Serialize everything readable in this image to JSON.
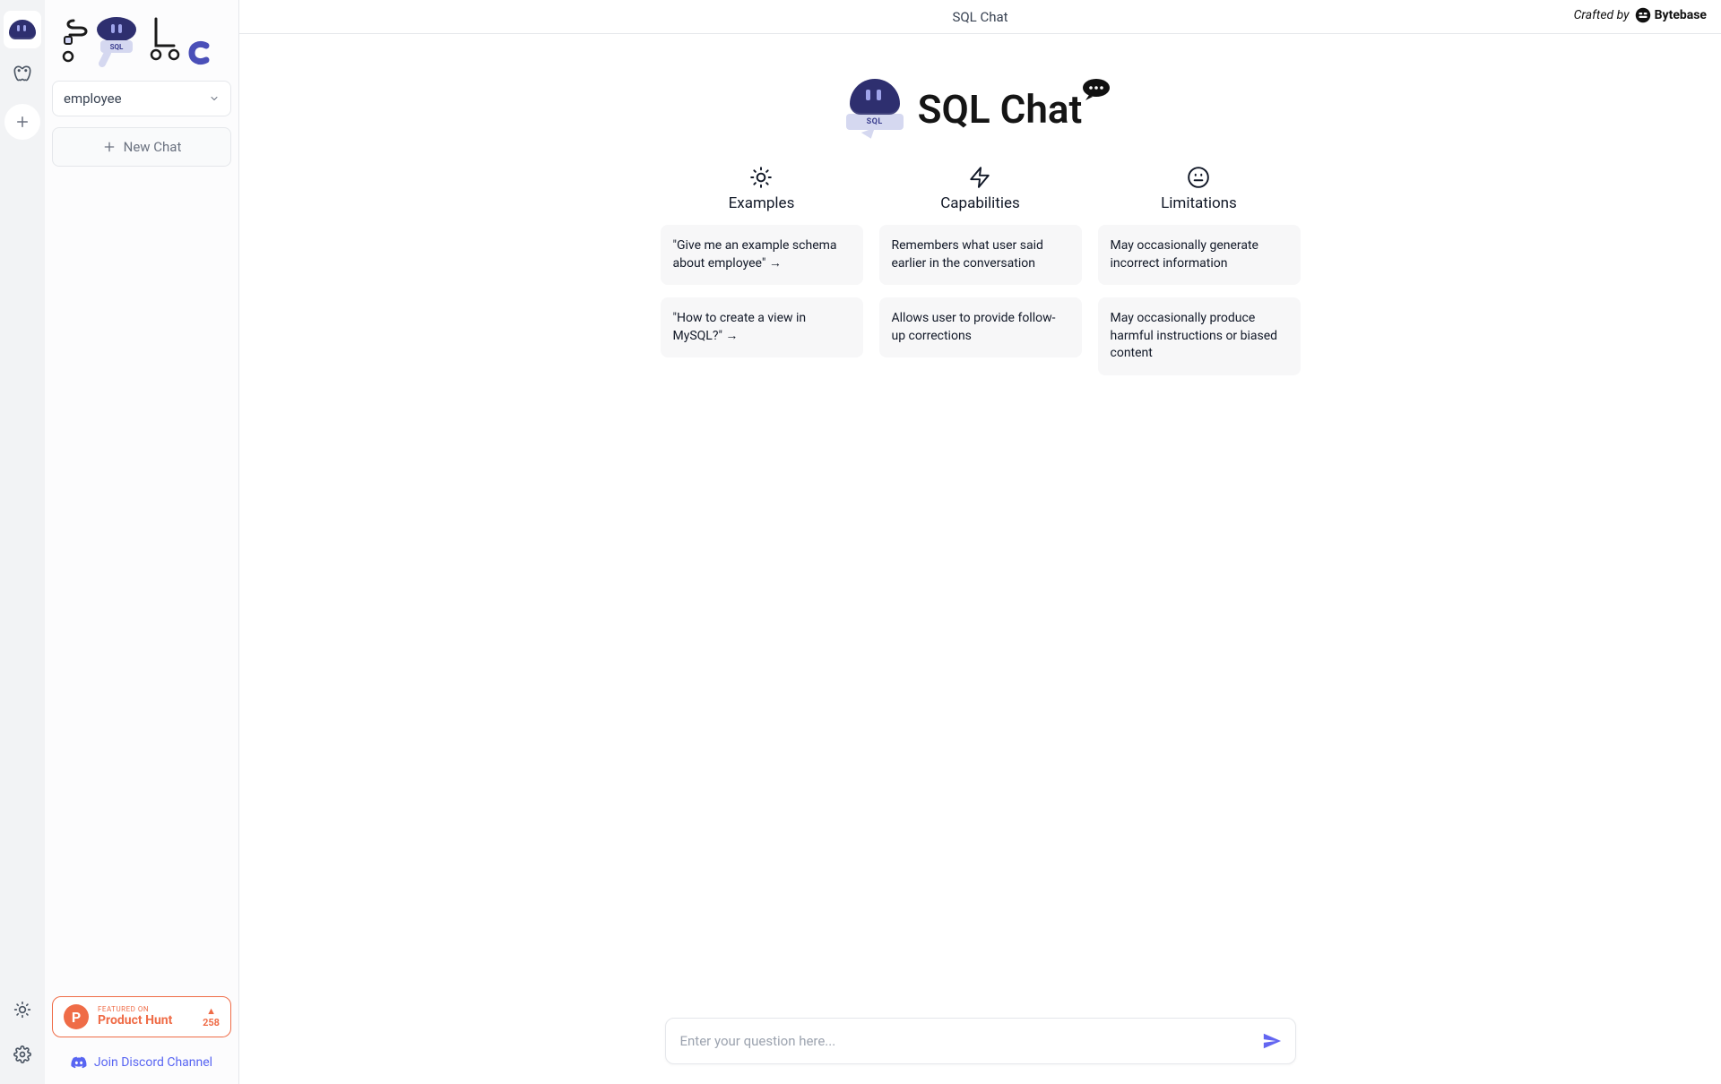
{
  "header": {
    "title": "SQL Chat",
    "crafted_by": "Crafted by",
    "brand": "Bytebase"
  },
  "sidebar": {
    "logo_text": "SQLc",
    "selected_db": "employee",
    "new_chat": "New Chat",
    "ph_featured": "FEATURED ON",
    "ph_name": "Product Hunt",
    "ph_count": "258",
    "discord": "Join Discord Channel"
  },
  "hero": {
    "title": "SQL Chat"
  },
  "columns": {
    "examples": {
      "title": "Examples",
      "items": [
        "\"Give me an example schema about employee\" →",
        "\"How to create a view in MySQL?\" →"
      ]
    },
    "capabilities": {
      "title": "Capabilities",
      "items": [
        "Remembers what user said earlier in the conversation",
        "Allows user to provide follow-up corrections"
      ]
    },
    "limitations": {
      "title": "Limitations",
      "items": [
        "May occasionally generate incorrect information",
        "May occasionally produce harmful instructions or biased content"
      ]
    }
  },
  "composer": {
    "placeholder": "Enter your question here..."
  }
}
